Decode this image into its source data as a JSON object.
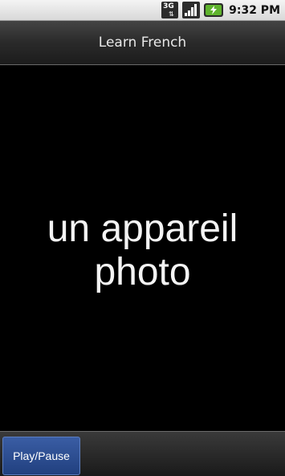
{
  "status_bar": {
    "network_label": "3G",
    "time": "9:32 PM",
    "icons": [
      "3g-data-icon",
      "signal-icon",
      "battery-charging-icon"
    ]
  },
  "title_bar": {
    "title": "Learn French"
  },
  "main": {
    "word_line1": "un appareil",
    "word_line2": "photo"
  },
  "bottom_bar": {
    "play_pause_label": "Play/Pause"
  },
  "colors": {
    "accent_button": "#2e4f93",
    "battery_green": "#5fb32d",
    "background": "#000000"
  }
}
